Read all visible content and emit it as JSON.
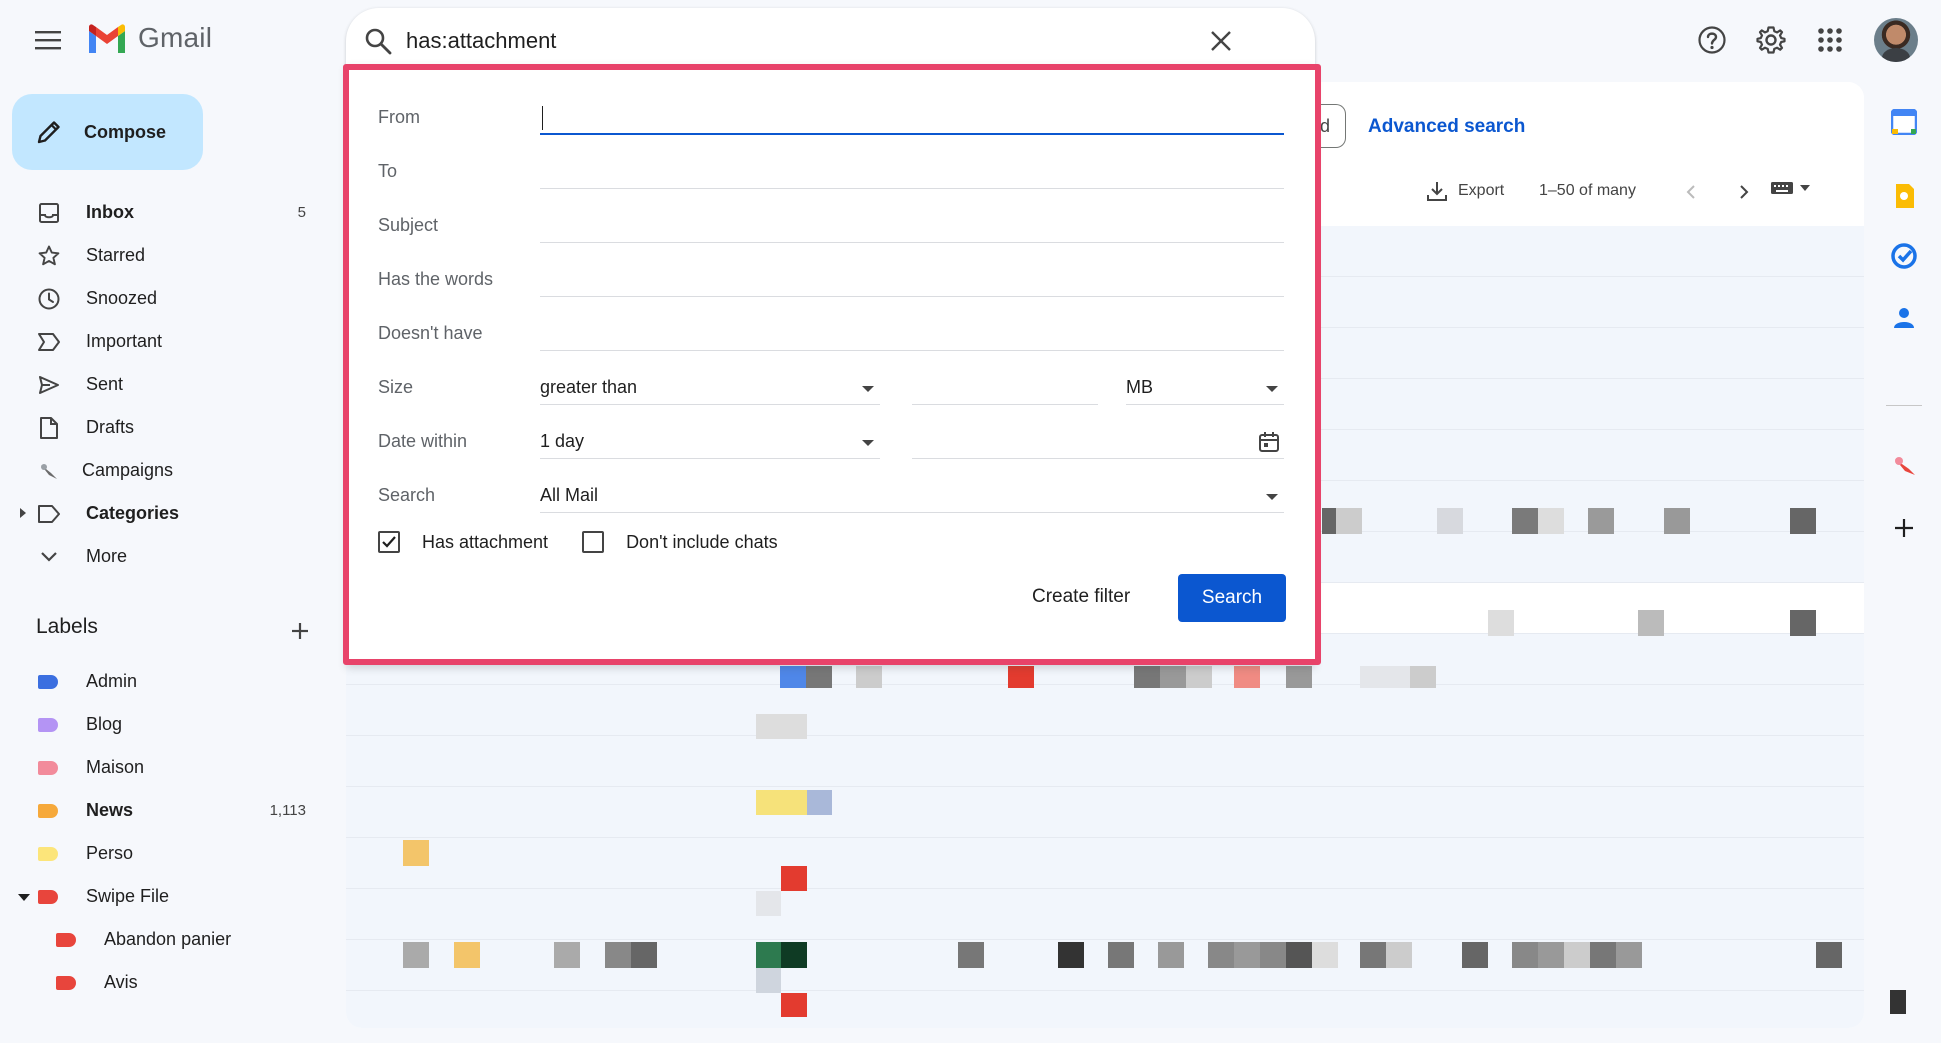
{
  "app": {
    "name": "Gmail"
  },
  "search": {
    "query": "has:attachment"
  },
  "sidebar": {
    "compose_label": "Compose",
    "items": [
      {
        "label": "Inbox",
        "count": "5",
        "bold": true,
        "icon": "inbox-icon"
      },
      {
        "label": "Starred",
        "count": "",
        "icon": "star-icon"
      },
      {
        "label": "Snoozed",
        "count": "",
        "icon": "clock-icon"
      },
      {
        "label": "Important",
        "count": "",
        "icon": "important-icon"
      },
      {
        "label": "Sent",
        "count": "",
        "icon": "send-icon"
      },
      {
        "label": "Drafts",
        "count": "",
        "icon": "draft-icon"
      },
      {
        "label": "Campaigns",
        "count": "",
        "icon": "campaigns-icon"
      },
      {
        "label": "Categories",
        "count": "",
        "bold": true,
        "icon": "categories-icon"
      },
      {
        "label": "More",
        "count": "",
        "icon": "chevron-down-icon"
      }
    ],
    "labels_title": "Labels",
    "labels": [
      {
        "label": "Admin",
        "color": "#3b6fe0",
        "count": ""
      },
      {
        "label": "Blog",
        "color": "#b494f4",
        "count": ""
      },
      {
        "label": "Maison",
        "color": "#f28b9b",
        "count": ""
      },
      {
        "label": "News",
        "color": "#f6a93b",
        "count": "1,113",
        "bold": true
      },
      {
        "label": "Perso",
        "color": "#fce57a",
        "count": ""
      },
      {
        "label": "Swipe File",
        "color": "#e8453c",
        "count": ""
      },
      {
        "label": "Abandon panier",
        "color": "#e8453c",
        "count": "",
        "sub": true
      },
      {
        "label": "Avis",
        "color": "#e8453c",
        "count": "",
        "sub": true
      }
    ]
  },
  "toolbar": {
    "advanced_search": "Advanced search",
    "chip_fragment": "d",
    "export_label": "Export",
    "pagination": "1–50 of many"
  },
  "advanced": {
    "from_label": "From",
    "to_label": "To",
    "subject_label": "Subject",
    "has_words_label": "Has the words",
    "doesnt_have_label": "Doesn't have",
    "size_label": "Size",
    "size_operator": "greater than",
    "size_unit": "MB",
    "date_label": "Date within",
    "date_value": "1 day",
    "search_label": "Search",
    "search_scope": "All Mail",
    "has_attachment_label": "Has attachment",
    "has_attachment_checked": true,
    "no_chats_label": "Don't include chats",
    "no_chats_checked": false,
    "create_filter_label": "Create filter",
    "search_button_label": "Search"
  },
  "colors": {
    "accent": "#0b57d0",
    "compose_bg": "#c2e7ff",
    "highlight_border": "#e8436a"
  }
}
